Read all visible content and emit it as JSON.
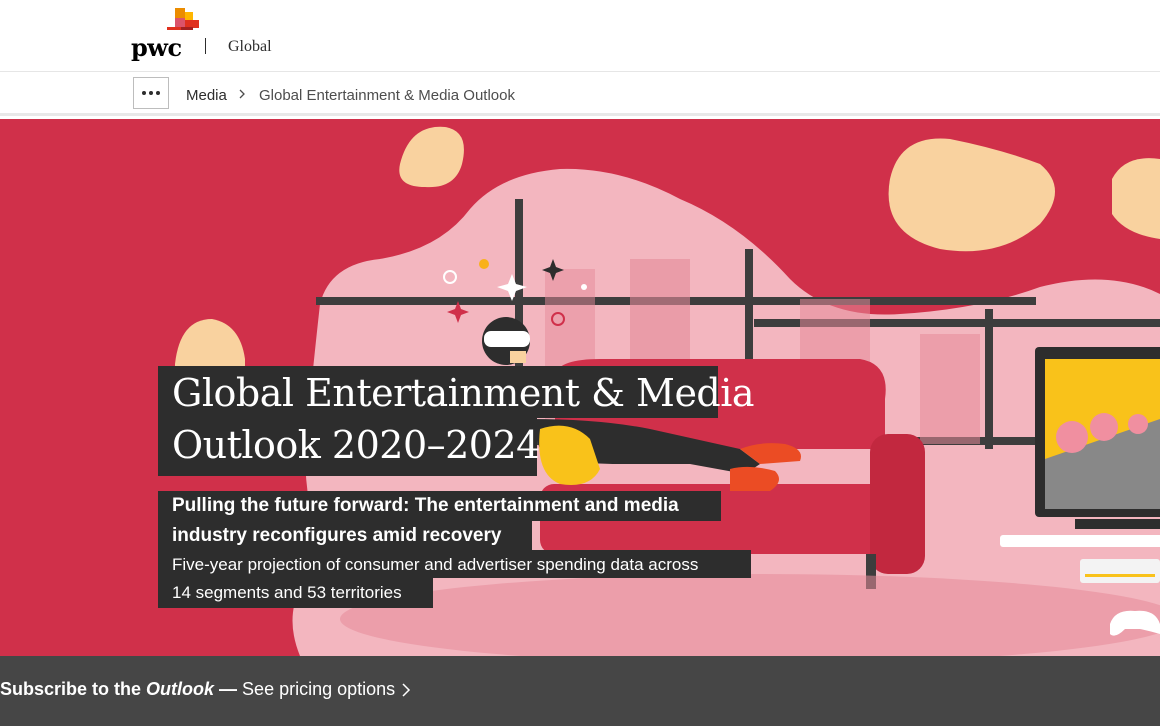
{
  "header": {
    "logo_text": "pwc",
    "territory": "Global"
  },
  "breadcrumb": {
    "items": [
      {
        "label": "Media"
      },
      {
        "label": "Global Entertainment & Media Outlook"
      }
    ]
  },
  "hero": {
    "title_line1": "Global Entertainment & Media",
    "title_line2": "Outlook 2020–2024",
    "subtitle_line1": "Pulling the future forward: The entertainment and media",
    "subtitle_line2": "industry reconfigures amid recovery",
    "description_line1": "Five-year projection of consumer and advertiser spending data across",
    "description_line2": "14 segments and 53 territories",
    "illustration": "person-with-vr-headset-on-couch",
    "colors": {
      "background": "#d0304a",
      "text_box": "#2d2d2d"
    }
  },
  "subscribe": {
    "lead": "Subscribe to the ",
    "title": "Outlook",
    "dash": " — ",
    "link_text": "See pricing options"
  },
  "icons": {
    "more": "more-dots-icon",
    "separator": "chevron-right-icon",
    "link": "chevron-right-icon"
  },
  "colors": {
    "subscribe_bar": "#464646",
    "logo_orange": "#e0301e"
  }
}
